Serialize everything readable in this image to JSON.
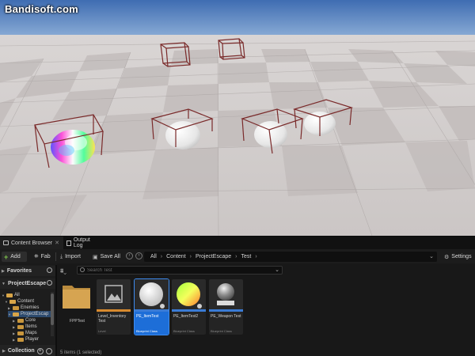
{
  "watermark": "Bandisoft.com",
  "colors": {
    "sky": "#5f87c4",
    "floor_light": "#d2cdcc",
    "floor_dark": "#b9b3b2",
    "bounds_box": "#7a2a2a",
    "selection_blue": "#1d6ed8",
    "blueprint_accent": "#3a7bd5",
    "material_accent": "#7bbd3c"
  },
  "tabs": [
    {
      "label": "Content Browser",
      "icon": "content-browser-icon"
    },
    {
      "label": "Output Log",
      "icon": "output-log-icon"
    }
  ],
  "toolbar": {
    "add": "Add",
    "fab": "Fab",
    "import": "Import",
    "save_all": "Save All",
    "settings": "Settings"
  },
  "breadcrumb": [
    "All",
    "Content",
    "ProjectEscape",
    "Test"
  ],
  "sidebar": {
    "favorites": "Favorites",
    "project": "ProjectEscape",
    "tree": [
      {
        "label": "All"
      },
      {
        "label": "Content"
      },
      {
        "label": "Enemies"
      },
      {
        "label": "ProjectEscap"
      },
      {
        "label": "Core"
      },
      {
        "label": "Items"
      },
      {
        "label": "Maps"
      },
      {
        "label": "Player"
      }
    ],
    "collections": "Collection"
  },
  "search": {
    "placeholder": "Search Test",
    "value": ""
  },
  "assets": [
    {
      "name": "FPPTest",
      "type": "",
      "kind": "folder",
      "selected": false
    },
    {
      "name": "Level_Inventory Test",
      "type": "Level",
      "kind": "level",
      "selected": false
    },
    {
      "name": "PE_ItemTest",
      "type": "Blueprint Class",
      "kind": "white-sphere",
      "selected": true
    },
    {
      "name": "PE_ItemTest2",
      "type": "Blueprint Class",
      "kind": "color-sphere",
      "selected": false
    },
    {
      "name": "PE_Weapon Test",
      "type": "Blueprint Class",
      "kind": "chrome-sphere",
      "selected": false
    }
  ],
  "status": "5 items (1 selected)"
}
